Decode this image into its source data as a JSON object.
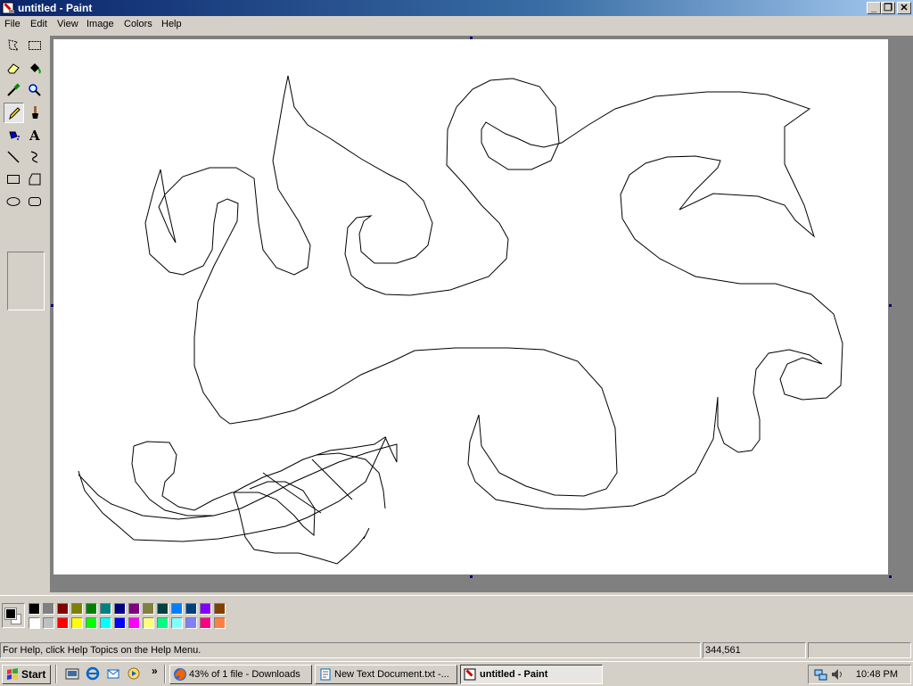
{
  "window": {
    "title": "untitled - Paint"
  },
  "menu": [
    "File",
    "Edit",
    "View",
    "Image",
    "Colors",
    "Help"
  ],
  "tools": [
    {
      "name": "free-form-select",
      "icon": "free-form-select-icon"
    },
    {
      "name": "select",
      "icon": "rect-select-icon"
    },
    {
      "name": "eraser",
      "icon": "eraser-icon"
    },
    {
      "name": "fill",
      "icon": "fill-bucket-icon"
    },
    {
      "name": "pick-color",
      "icon": "eyedropper-icon"
    },
    {
      "name": "magnifier",
      "icon": "magnifier-icon"
    },
    {
      "name": "pencil",
      "icon": "pencil-icon",
      "active": true
    },
    {
      "name": "brush",
      "icon": "brush-icon"
    },
    {
      "name": "airbrush",
      "icon": "airbrush-icon"
    },
    {
      "name": "text",
      "icon": "text-icon",
      "glyph": "A"
    },
    {
      "name": "line",
      "icon": "line-icon"
    },
    {
      "name": "curve",
      "icon": "curve-icon"
    },
    {
      "name": "rectangle",
      "icon": "rectangle-icon"
    },
    {
      "name": "polygon",
      "icon": "polygon-icon"
    },
    {
      "name": "ellipse",
      "icon": "ellipse-icon"
    },
    {
      "name": "rounded-rectangle",
      "icon": "rounded-rectangle-icon"
    }
  ],
  "colors": {
    "foreground": "#000000",
    "background": "#ffffff",
    "palette_top": [
      "#000000",
      "#808080",
      "#800000",
      "#808000",
      "#008000",
      "#008080",
      "#000080",
      "#800080",
      "#808040",
      "#004040",
      "#0080ff",
      "#004080",
      "#8000ff",
      "#804000"
    ],
    "palette_bottom": [
      "#ffffff",
      "#c0c0c0",
      "#ff0000",
      "#ffff00",
      "#00ff00",
      "#00ffff",
      "#0000ff",
      "#ff00ff",
      "#ffff80",
      "#00ff80",
      "#80ffff",
      "#8080ff",
      "#ff0080",
      "#ff8040"
    ]
  },
  "status": {
    "help_text": "For Help, click Help Topics on the Help Menu.",
    "cursor_pos": "344,561",
    "selection_size": ""
  },
  "taskbar": {
    "start_label": "Start",
    "quick_launch": [
      "show-desktop-icon",
      "internet-explorer-icon",
      "outlook-express-icon",
      "windows-media-icon"
    ],
    "chevron": "»",
    "tasks": [
      {
        "label": "43% of 1 file - Downloads",
        "icon": "firefox-icon"
      },
      {
        "label": "New Text Document.txt -...",
        "icon": "notepad-icon"
      },
      {
        "label": "untitled - Paint",
        "icon": "paint-icon",
        "active": true
      }
    ],
    "tray_icons": [
      "network-icon",
      "volume-icon"
    ],
    "clock": "10:48 PM"
  }
}
